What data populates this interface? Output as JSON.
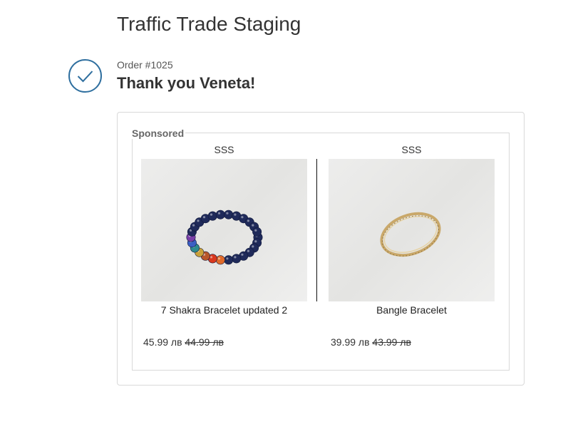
{
  "shop": {
    "title": "Traffic Trade Staging"
  },
  "order": {
    "number": "Order #1025",
    "thank_you": "Thank you Veneta!",
    "status_icon": "checkmark-circle-icon",
    "accent_color": "#2f6f9f"
  },
  "sponsored": {
    "label": "Sponsored",
    "products": [
      {
        "vendor": "SSS",
        "title": "7 Shakra Bracelet updated 2",
        "price": "45.99 лв",
        "compare_price": "44.99 лв",
        "image": "beaded-chakra-bracelet"
      },
      {
        "vendor": "SSS",
        "title": "Bangle Bracelet",
        "price": "39.99 лв",
        "compare_price": "43.99 лв",
        "image": "gold-bangle-bracelet"
      }
    ]
  }
}
